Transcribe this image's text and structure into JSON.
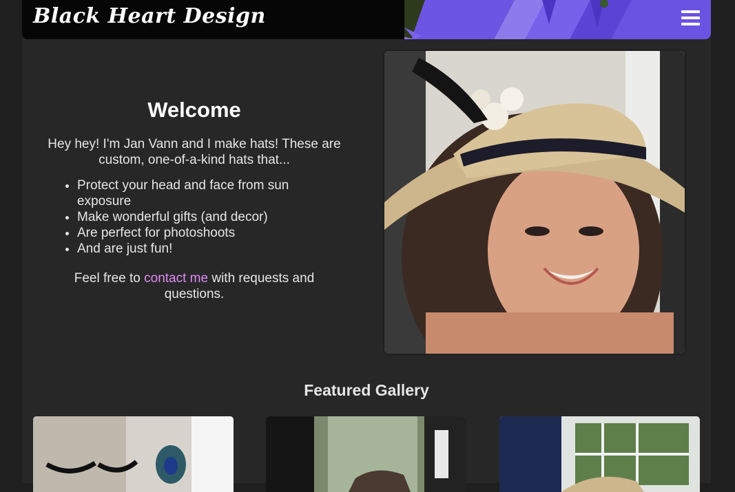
{
  "brand": {
    "name": "Black Heart Design"
  },
  "header": {
    "menu_icon": "hamburger-menu-icon"
  },
  "welcome": {
    "title": "Welcome",
    "intro": "Hey hey! I'm Jan Vann and I make hats! These are custom, one-of-a-kind hats that...",
    "bullets": [
      "Protect your head and face from sun exposure",
      "Make wonderful gifts (and decor)",
      "Are perfect for photoshoots",
      "And are just fun!"
    ],
    "contact_prefix": "Feel free to ",
    "contact_link": "contact me",
    "contact_suffix": " with requests and questions."
  },
  "gallery": {
    "title": "Featured Gallery"
  },
  "colors": {
    "background": "#1f1f1f",
    "panel": "#272727",
    "header": "#060606",
    "link": "#e089f5",
    "accent_purple": "#6a4ee0"
  }
}
